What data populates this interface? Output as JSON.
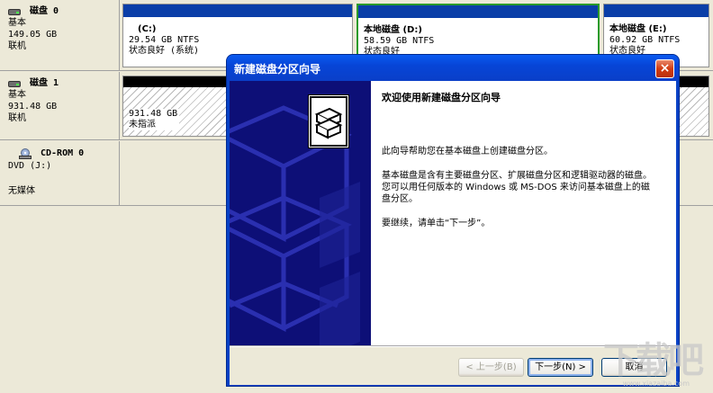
{
  "disks": [
    {
      "title": "磁盘 0",
      "type": "基本",
      "size": "149.05 GB",
      "status": "联机",
      "partitions": [
        {
          "label": "(C:)",
          "size": "29.54 GB NTFS",
          "status": "状态良好 (系统)"
        },
        {
          "label": "本地磁盘  (D:)",
          "size": "58.59 GB NTFS",
          "status": "状态良好"
        },
        {
          "label": "本地磁盘  (E:)",
          "size": "60.92 GB NTFS",
          "status": "状态良好"
        }
      ]
    },
    {
      "title": "磁盘 1",
      "type": "基本",
      "size": "931.48 GB",
      "status": "联机",
      "partitions": [
        {
          "label": "",
          "size": "931.48 GB",
          "status": "未指派"
        }
      ]
    }
  ],
  "cdrom": {
    "title": "CD-ROM 0",
    "drive": "DVD (J:)",
    "status": "无媒体"
  },
  "wizard": {
    "title": "新建磁盘分区向导",
    "close_label": "×",
    "heading": "欢迎使用新建磁盘分区向导",
    "para1": "此向导帮助您在基本磁盘上创建磁盘分区。",
    "para2": "基本磁盘是含有主要磁盘分区、扩展磁盘分区和逻辑驱动器的磁盘。您可以用任何版本的 Windows 或 MS-DOS 来访问基本磁盘上的磁盘分区。",
    "para3": "要继续，请单击“下一步”。",
    "back_label": "< 上一步(B)",
    "next_label": "下一步(N) >",
    "cancel_label": "取消"
  },
  "watermark": {
    "logo": "下载吧",
    "url": "www.xiazaiba.com"
  },
  "colors": {
    "partition_bar_primary": "#0a3ea8",
    "partition_bar_unallocated": "#000000",
    "wizard_titlebar": "#0745d7",
    "wizard_side_panel": "#0d0f77",
    "close_button": "#d23c12"
  }
}
